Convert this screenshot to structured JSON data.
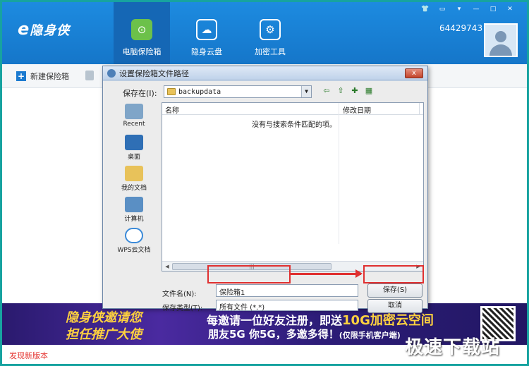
{
  "app": {
    "logo_text": "隐身侠",
    "logo_prefix": "e",
    "nav": [
      {
        "label": "电脑保险箱",
        "icon": "safe-icon"
      },
      {
        "label": "隐身云盘",
        "icon": "cloud-icon"
      },
      {
        "label": "加密工具",
        "icon": "tools-icon"
      }
    ],
    "user_id": "64429743",
    "window_controls": [
      "shirt-icon",
      "message-icon",
      "menu-icon",
      "minimize-icon",
      "maximize-icon",
      "close-icon"
    ]
  },
  "toolbar": {
    "new_vault": "新建保险箱"
  },
  "dialog": {
    "title": "设置保险箱文件路径",
    "close": "x",
    "save_in_label": "保存在(I):",
    "save_in_value": "backupdata",
    "places": [
      {
        "label": "Recent",
        "icon": "recent-icon"
      },
      {
        "label": "桌面",
        "icon": "desktop-icon"
      },
      {
        "label": "我的文档",
        "icon": "documents-icon"
      },
      {
        "label": "计算机",
        "icon": "computer-icon"
      },
      {
        "label": "WPS云文档",
        "icon": "wps-cloud-icon"
      }
    ],
    "columns": {
      "name": "名称",
      "date": "修改日期"
    },
    "empty_message": "没有与搜索条件匹配的项。",
    "filename_label": "文件名(N):",
    "filename_value": "保险箱1",
    "filetype_label": "保存类型(T):",
    "filetype_value": "所有文件 (*.*)",
    "save_button": "保存(S)",
    "cancel_button": "取消"
  },
  "banner": {
    "slogan_line1": "隐身侠邀请您",
    "slogan_line2": "担任推广大使",
    "line1_pre": "每邀请一位好友注册，即送",
    "line1_highlight": "10G加密云空间",
    "line2_main": "朋友5G  你5G，多邀多得！",
    "line2_note": "(仅限手机客户端)"
  },
  "status": {
    "text": "发现新版本"
  },
  "watermark": "极速下载站",
  "colors": {
    "titlebar": "#1d8be0",
    "frame": "#17a3a0",
    "highlight": "#e03030",
    "status_text": "#e53935"
  }
}
